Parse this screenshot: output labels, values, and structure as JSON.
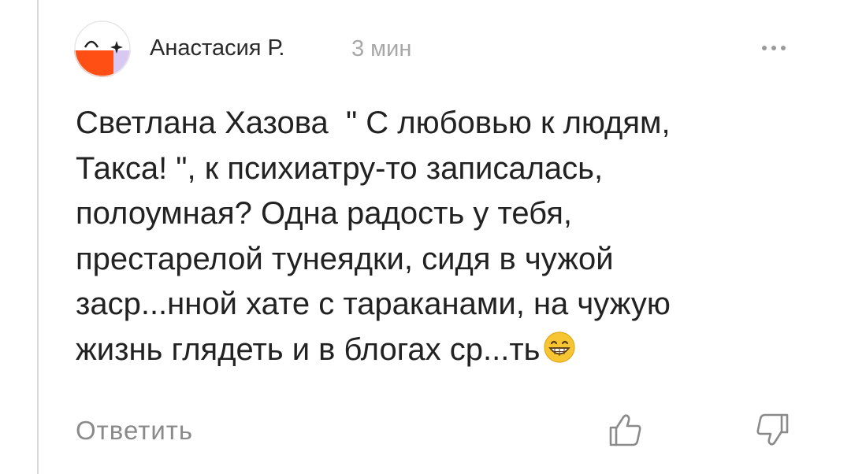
{
  "comment": {
    "author": "Анастасия Р.",
    "time": "3 мин",
    "text": "Светлана Хазова  \" С любовью к людям,\nТакса! \", к психиатру-то записалась,\nполоумная? Одна радость у тебя,\nпрестарелой тунеядки, сидя в чужой\nзаср...нной хате с тараканами, на чужую\nжизнь глядеть и в блогах ср...ть",
    "emoji": "grinning-face-emoji"
  },
  "actions": {
    "reply_label": "Ответить",
    "like_icon": "thumbs-up-icon",
    "dislike_icon": "thumbs-down-icon",
    "more_icon": "more-dots-icon"
  },
  "colors": {
    "text": "#222222",
    "muted": "#a8a8a8",
    "action": "#8a8a8a",
    "avatar_orange": "#ff4f14",
    "avatar_lilac": "#d8c8f2"
  }
}
